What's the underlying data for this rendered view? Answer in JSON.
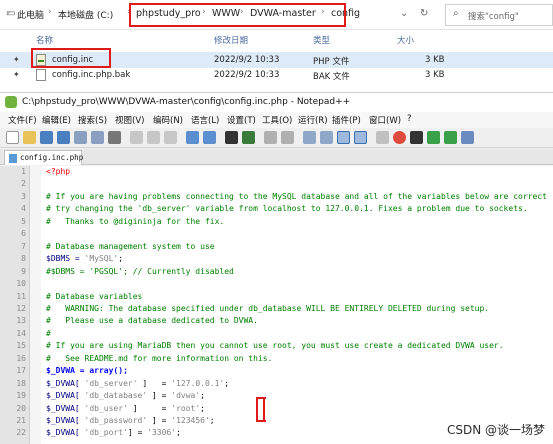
{
  "explorer": {
    "breadcrumbs": [
      "此电脑",
      "本地磁盘 (C:)",
      "phpstudy_pro",
      "WWW",
      "DVWA-master",
      "config"
    ],
    "search_placeholder": "搜索\"config\"",
    "columns": {
      "name": "名称",
      "modified": "修改日期",
      "type": "类型",
      "size": "大小"
    },
    "files": [
      {
        "name": "config.inc",
        "modified": "2022/9/2 10:33",
        "type": "PHP 文件",
        "size": "3 KB"
      },
      {
        "name": "config.inc.php.bak",
        "modified": "2022/9/2 10:33",
        "type": "BAK 文件",
        "size": "3 KB"
      }
    ]
  },
  "notepad": {
    "title": "C:\\phpstudy_pro\\WWW\\DVWA-master\\config\\config.inc.php - Notepad++",
    "menu": [
      "文件(F)",
      "编辑(E)",
      "搜索(S)",
      "视图(V)",
      "编码(N)",
      "语言(L)",
      "设置(T)",
      "工具(O)",
      "运行(R)",
      "插件(P)",
      "窗口(W)",
      "?"
    ],
    "tab": "config.inc.php",
    "lines": [
      {
        "n": "1",
        "t": "<?php",
        "c": "php"
      },
      {
        "n": "2",
        "t": "",
        "c": "plain"
      },
      {
        "n": "3",
        "t": "# If you are having problems connecting to the MySQL database and all of the variables below are correct",
        "c": "com"
      },
      {
        "n": "4",
        "t": "# try changing the 'db_server' variable from localhost to 127.0.0.1. Fixes a problem due to sockets.",
        "c": "com"
      },
      {
        "n": "5",
        "t": "#   Thanks to @digininja for the fix.",
        "c": "com"
      },
      {
        "n": "6",
        "t": "",
        "c": "plain"
      },
      {
        "n": "7",
        "t": "# Database management system to use",
        "c": "com"
      },
      {
        "n": "8",
        "t": "$DBMS = 'MySQL';",
        "c": "plain"
      },
      {
        "n": "9",
        "t": "#$DBMS = 'PGSQL'; // Currently disabled",
        "c": "com"
      },
      {
        "n": "10",
        "t": "",
        "c": "plain"
      },
      {
        "n": "11",
        "t": "# Database variables",
        "c": "com"
      },
      {
        "n": "12",
        "t": "#   WARNING: The database specified under db_database WILL BE ENTIRELY DELETED during setup.",
        "c": "com"
      },
      {
        "n": "13",
        "t": "#   Please use a database dedicated to DVWA.",
        "c": "com"
      },
      {
        "n": "14",
        "t": "#",
        "c": "com"
      },
      {
        "n": "15",
        "t": "# If you are using MariaDB then you cannot use root, you must use create a dedicated DVWA user.",
        "c": "com"
      },
      {
        "n": "16",
        "t": "#   See README.md for more information on this.",
        "c": "com"
      },
      {
        "n": "17",
        "t": "$_DVWA = array();",
        "c": "plain"
      },
      {
        "n": "18",
        "t": "$_DVWA[ 'db_server' ]   = '127.0.0.1';",
        "c": "plain"
      },
      {
        "n": "19",
        "t": "$_DVWA[ 'db_database' ] = 'dvwa';",
        "c": "plain"
      },
      {
        "n": "20",
        "t": "$_DVWA[ 'db_user' ]     = 'root';",
        "c": "plain"
      },
      {
        "n": "21",
        "t": "$_DVWA[ 'db_password' ] = '123456';",
        "c": "plain"
      },
      {
        "n": "22",
        "t": "$_DVWA[ 'db_port'] = '3306';",
        "c": "plain"
      }
    ]
  },
  "watermark": "CSDN @谈一场梦"
}
